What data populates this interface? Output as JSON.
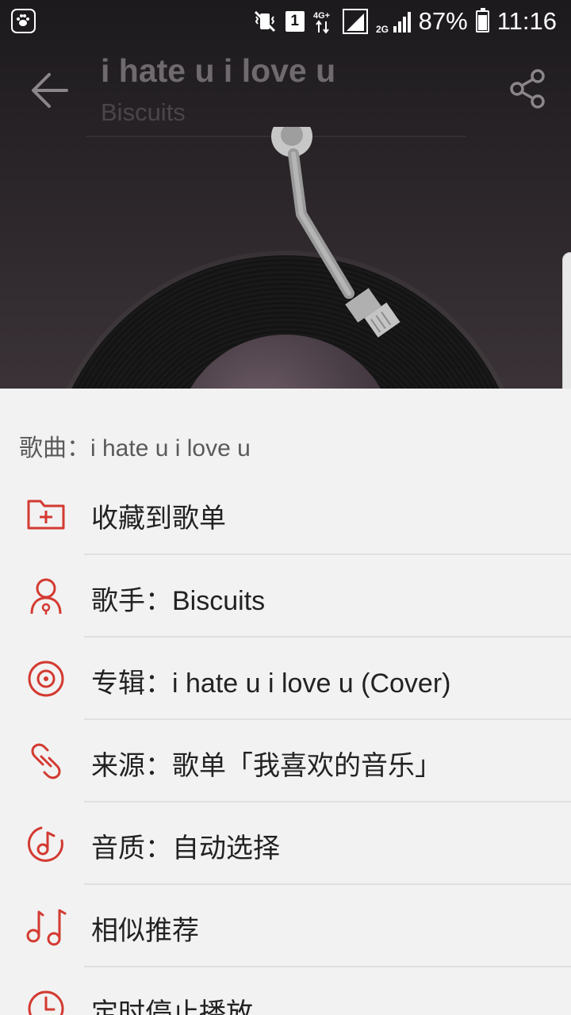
{
  "status_bar": {
    "app_icon": "baidu-icon",
    "icons": [
      "vibrate-mute-icon",
      "sim-1-icon",
      "4g-data-icon",
      "signal-icon",
      "2g-signal-icon"
    ],
    "sim_number": "1",
    "battery": "87%",
    "time": "11:16"
  },
  "header": {
    "title": "i hate u i love u",
    "artist": "Biscuits",
    "back_icon": "arrow-left-icon",
    "share_icon": "share-icon"
  },
  "sheet": {
    "header": "歌曲：i hate u i love u",
    "items": [
      {
        "icon": "folder-add-icon",
        "label": "收藏到歌单"
      },
      {
        "icon": "singer-icon",
        "label": "歌手：Biscuits"
      },
      {
        "icon": "album-icon",
        "label": "专辑：i hate u i love u (Cover)"
      },
      {
        "icon": "link-icon",
        "label": "来源：歌单「我喜欢的音乐」"
      },
      {
        "icon": "sound-quality-icon",
        "label": "音质：自动选择"
      },
      {
        "icon": "music-notes-icon",
        "label": "相似推荐"
      },
      {
        "icon": "timer-icon",
        "label": "定时停止播放"
      }
    ]
  },
  "colors": {
    "accent": "#d33a31",
    "player_bg": "#231f22",
    "sheet_bg": "#f2f2f2"
  }
}
